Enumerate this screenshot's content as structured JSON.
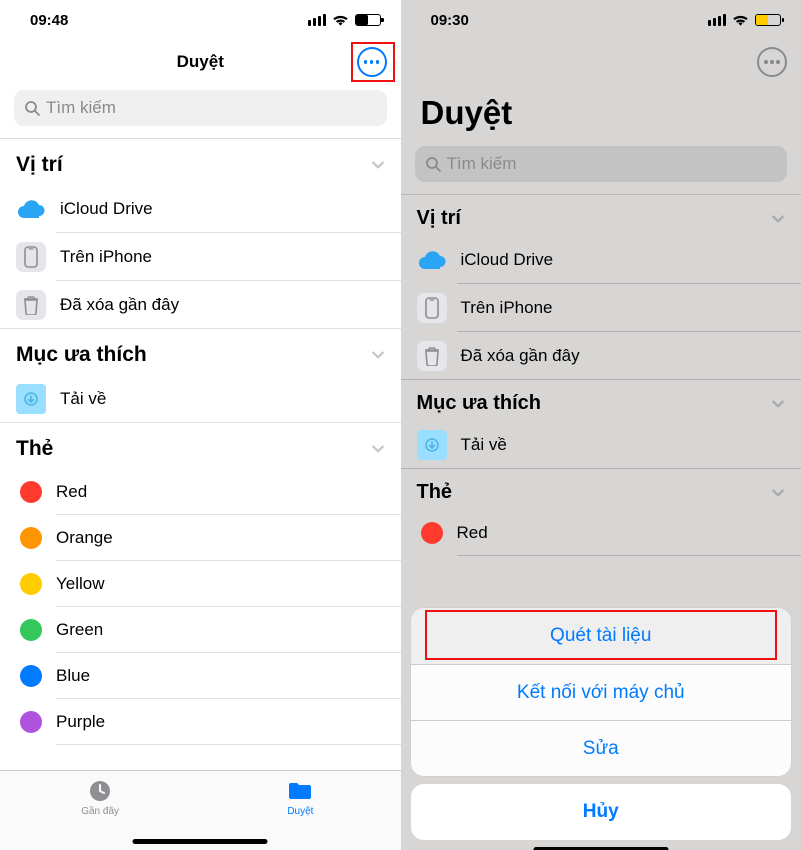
{
  "left": {
    "status_time": "09:48",
    "nav_title": "Duyệt",
    "search_placeholder": "Tìm kiếm",
    "sections": {
      "locations": {
        "title": "Vị trí",
        "items": [
          {
            "label": "iCloud Drive"
          },
          {
            "label": "Trên iPhone"
          },
          {
            "label": "Đã xóa gần đây"
          }
        ]
      },
      "favorites": {
        "title": "Mục ưa thích",
        "items": [
          {
            "label": "Tải về"
          }
        ]
      },
      "tags": {
        "title": "Thẻ",
        "items": [
          {
            "label": "Red",
            "color": "#ff3b30"
          },
          {
            "label": "Orange",
            "color": "#ff9500"
          },
          {
            "label": "Yellow",
            "color": "#ffcc00"
          },
          {
            "label": "Green",
            "color": "#34c759"
          },
          {
            "label": "Blue",
            "color": "#007aff"
          },
          {
            "label": "Purple",
            "color": "#af52de"
          }
        ]
      }
    },
    "tabs": {
      "recent": "Gần đây",
      "browse": "Duyệt"
    }
  },
  "right": {
    "status_time": "09:30",
    "large_title": "Duyệt",
    "search_placeholder": "Tìm kiếm",
    "sections": {
      "locations": {
        "title": "Vị trí",
        "items": [
          {
            "label": "iCloud Drive"
          },
          {
            "label": "Trên iPhone"
          },
          {
            "label": "Đã xóa gần đây"
          }
        ]
      },
      "favorites": {
        "title": "Mục ưa thích",
        "items": [
          {
            "label": "Tải về"
          }
        ]
      },
      "tags": {
        "title": "Thẻ",
        "items": [
          {
            "label": "Red",
            "color": "#ff3b30"
          }
        ]
      }
    },
    "sheet": {
      "scan": "Quét tài liệu",
      "connect": "Kết nối với máy chủ",
      "edit": "Sửa",
      "cancel": "Hủy"
    }
  }
}
